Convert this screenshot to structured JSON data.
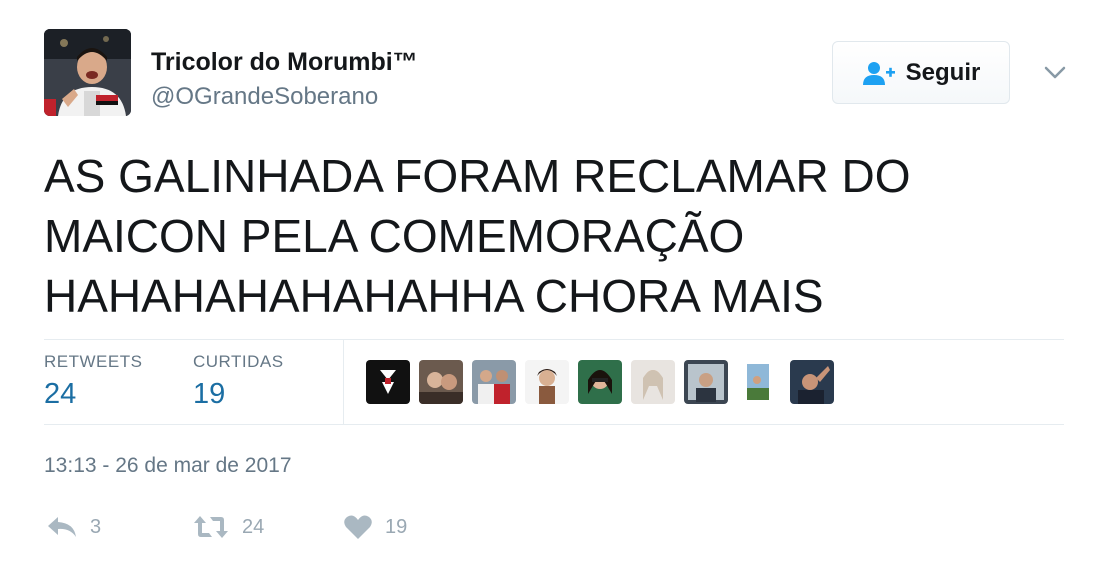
{
  "user": {
    "display_name": "Tricolor do Morumbi™",
    "handle": "@OGrandeSoberano"
  },
  "follow_button": {
    "label": "Seguir",
    "icon": "add-user-icon"
  },
  "menu": {
    "icon": "chevron-down-icon"
  },
  "tweet": {
    "lines": [
      "AS GALINHADA FORAM RECLAMAR DO",
      "MAICON PELA COMEMORAÇÃO",
      "HAHAHAHAHAHAHHA CHORA MAIS"
    ]
  },
  "stats": {
    "retweets_label": "RETWEETS",
    "retweets_value": "24",
    "likes_label": "CURTIDAS",
    "likes_value": "19"
  },
  "timestamp": "13:13 - 26 de mar de 2017",
  "actions": {
    "reply": {
      "icon": "reply-icon",
      "count": "3"
    },
    "retweet": {
      "icon": "retweet-icon",
      "count": "24"
    },
    "like": {
      "icon": "heart-icon",
      "count": "19"
    }
  },
  "colors": {
    "link_blue": "#1b6ea3",
    "secondary_gray": "#657786",
    "action_gray": "#9aa8b3",
    "text": "#14171a",
    "border": "#e6ecf0"
  }
}
